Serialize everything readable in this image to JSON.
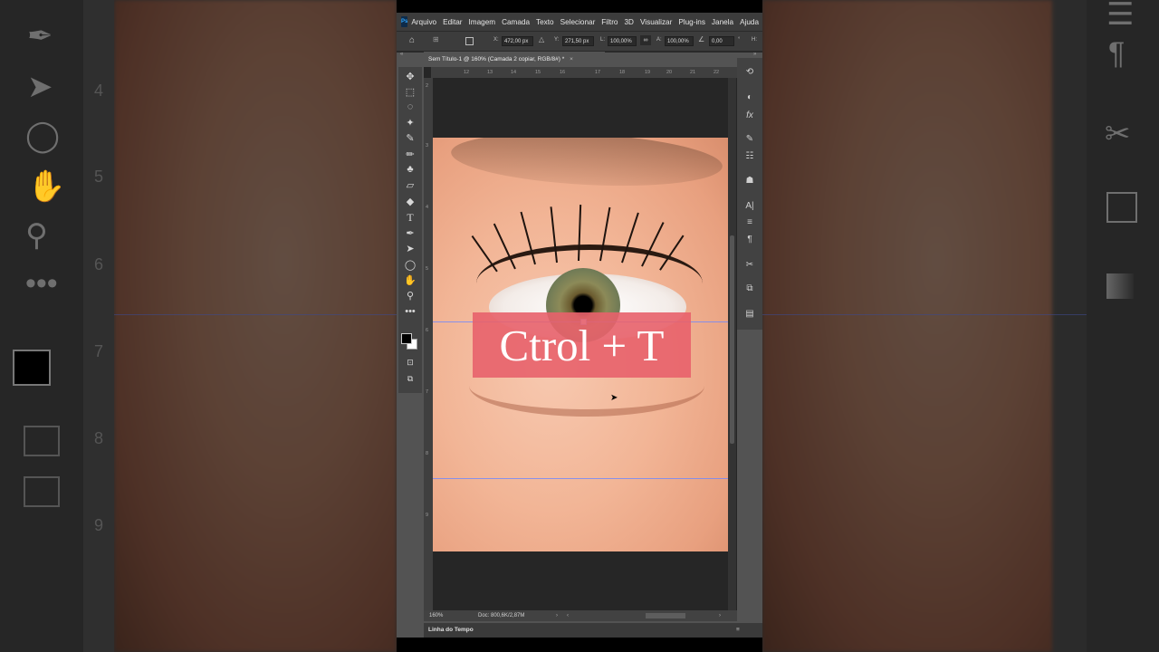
{
  "app": {
    "logo": "Ps"
  },
  "menu": [
    "Arquivo",
    "Editar",
    "Imagem",
    "Camada",
    "Texto",
    "Selecionar",
    "Filtro",
    "3D",
    "Visualizar",
    "Plug-ins",
    "Janela",
    "Ajuda"
  ],
  "options": {
    "x_label": "X:",
    "x_value": "472,00 px",
    "y_label": "Y:",
    "y_value": "271,50 px",
    "w_label": "L:",
    "w_value": "100,00%",
    "h_label": "A:",
    "h_value": "100,00%",
    "angle_value": "0,00",
    "angle_unit": "°",
    "h_trail": "H:"
  },
  "document": {
    "tab_title": "Sem Título-1 @ 160% (Camada 2 copiar, RGB/8#) *",
    "tab_close": "×",
    "zoom": "160%",
    "doc_size": "Doc: 800,6K/2,87M"
  },
  "overlay_text": "Ctrol + T",
  "ruler": {
    "top": [
      "12",
      "13",
      "14",
      "15",
      "16",
      "17",
      "18",
      "19",
      "20",
      "21",
      "22"
    ],
    "left": [
      "2",
      "3",
      "4",
      "5",
      "6",
      "7",
      "8",
      "9"
    ]
  },
  "bg_ruler_numbers": [
    "4",
    "5",
    "6",
    "7",
    "8",
    "9"
  ],
  "timeline_label": "Linha do Tempo",
  "tools_icons": [
    "move-icon",
    "marquee-icon",
    "lasso-icon",
    "magic-wand-icon",
    "eyedropper-icon",
    "brush-icon",
    "stamp-icon",
    "eraser-icon",
    "paint-bucket-icon",
    "type-icon",
    "pen-icon",
    "path-select-icon",
    "ellipse-icon",
    "hand-icon",
    "zoom-icon",
    "more-icon"
  ],
  "panel_icons": [
    "history-icon",
    "adjust-icon",
    "fx-icon",
    "brush-settings-icon",
    "properties-icon",
    "libraries-icon",
    "character-icon",
    "paragraph-settings-icon",
    "paragraph-icon",
    "cut-icon",
    "export-icon",
    "gradient-icon"
  ]
}
